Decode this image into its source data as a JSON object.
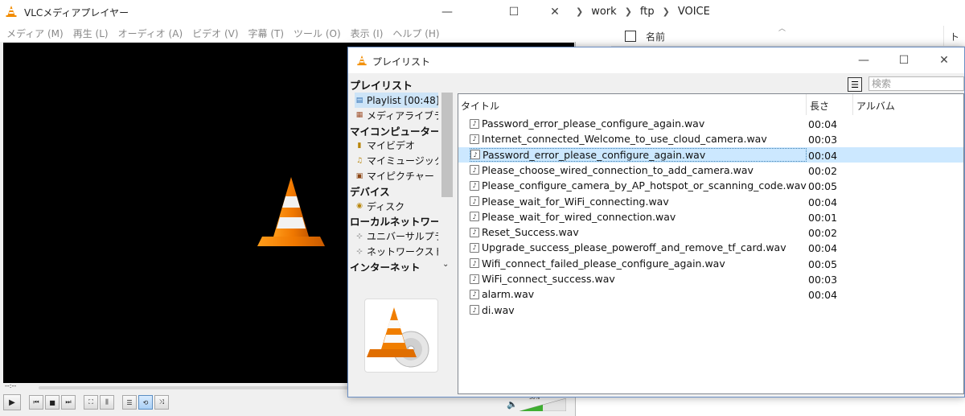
{
  "explorer": {
    "breadcrumb": [
      "work",
      "ftp",
      "VOICE"
    ],
    "column_name": "名前",
    "column_track": "トラ"
  },
  "vlc": {
    "title": "VLCメディアプレイヤー",
    "menus": [
      "メディア (M)",
      "再生 (L)",
      "オーディオ (A)",
      "ビデオ (V)",
      "字幕 (T)",
      "ツール (O)",
      "表示 (I)",
      "ヘルプ (H)"
    ],
    "time_left": "--:--",
    "volume_percent": "50%",
    "volume_level": 0.5
  },
  "playlist": {
    "window_title": "プレイリスト",
    "heading": "プレイリスト",
    "search_placeholder": "検索",
    "tree": [
      {
        "label": "Playlist [00:48]",
        "type": "child",
        "icon": "playlist-icon",
        "selected": true
      },
      {
        "label": "メディアライブラリ",
        "type": "child",
        "icon": "library-icon"
      },
      {
        "label": "マイコンピューター",
        "type": "section"
      },
      {
        "label": "マイビデオ",
        "type": "child",
        "icon": "video-icon"
      },
      {
        "label": "マイミュージック",
        "type": "child",
        "icon": "music-icon"
      },
      {
        "label": "マイピクチャー",
        "type": "child",
        "icon": "picture-icon"
      },
      {
        "label": "デバイス",
        "type": "section"
      },
      {
        "label": "ディスク",
        "type": "child",
        "icon": "disc-icon"
      },
      {
        "label": "ローカルネットワーク",
        "type": "section"
      },
      {
        "label": "ユニバーサルプラ...",
        "type": "child",
        "icon": "network-icon"
      },
      {
        "label": "ネットワークストリー...",
        "type": "child",
        "icon": "network-icon"
      },
      {
        "label": "インターネット",
        "type": "section"
      }
    ],
    "columns": {
      "title": "タイトル",
      "duration": "長さ",
      "album": "アルバム"
    },
    "rows": [
      {
        "name": "Password_error_please_configure_again.wav",
        "duration": "00:04"
      },
      {
        "name": "Internet_connected_Welcome_to_use_cloud_camera.wav",
        "duration": "00:03"
      },
      {
        "name": "Password_error_please_configure_again.wav",
        "duration": "00:04",
        "selected": true
      },
      {
        "name": "Please_choose_wired_connection_to_add_camera.wav",
        "duration": "00:02"
      },
      {
        "name": "Please_configure_camera_by_AP_hotspot_or_scanning_code.wav",
        "duration": "00:05"
      },
      {
        "name": "Please_wait_for_WiFi_connecting.wav",
        "duration": "00:04"
      },
      {
        "name": "Please_wait_for_wired_connection.wav",
        "duration": "00:01"
      },
      {
        "name": "Reset_Success.wav",
        "duration": "00:02"
      },
      {
        "name": "Upgrade_success_please_poweroff_and_remove_tf_card.wav",
        "duration": "00:04"
      },
      {
        "name": "Wifi_connect_failed_please_configure_again.wav",
        "duration": "00:05"
      },
      {
        "name": "WiFi_connect_success.wav",
        "duration": "00:03"
      },
      {
        "name": "alarm.wav",
        "duration": "00:04"
      },
      {
        "name": "di.wav",
        "duration": ""
      }
    ]
  }
}
